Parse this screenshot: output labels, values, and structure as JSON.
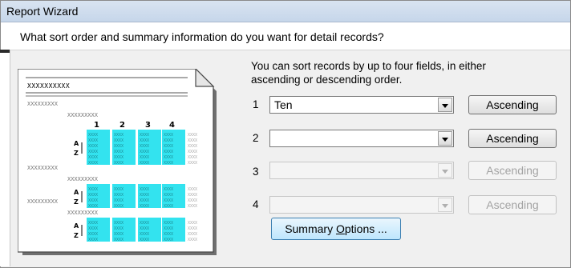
{
  "window": {
    "title": "Report Wizard"
  },
  "question": "What sort order and summary information do you want for detail records?",
  "info": {
    "line1": "You can sort records by up to four fields, in either",
    "line2": "ascending or descending order."
  },
  "sort_rows": [
    {
      "number": "1",
      "value": "Ten",
      "order_label": "Ascending",
      "enabled": true
    },
    {
      "number": "2",
      "value": "",
      "order_label": "Ascending",
      "enabled": true
    },
    {
      "number": "3",
      "value": "",
      "order_label": "Ascending",
      "enabled": false
    },
    {
      "number": "4",
      "value": "",
      "order_label": "Ascending",
      "enabled": false
    }
  ],
  "summary_button": {
    "label_before": "Summary ",
    "label_mnemonic": "O",
    "label_after": "ptions ..."
  },
  "preview": {
    "header_text": "XXXXXXXXXX",
    "group_text": "XXXXXXXXX",
    "column_numbers": [
      "1",
      "2",
      "3",
      "4"
    ],
    "sort_glyphs": [
      "A",
      "Z"
    ],
    "cell_text": "XXXX"
  },
  "colors": {
    "highlight": "#33e3ef",
    "button_focus_border": "#3c7fb1"
  },
  "icons": [
    "dropdown-arrow-icon",
    "sort-ascending-icon",
    "folded-page-icon"
  ]
}
